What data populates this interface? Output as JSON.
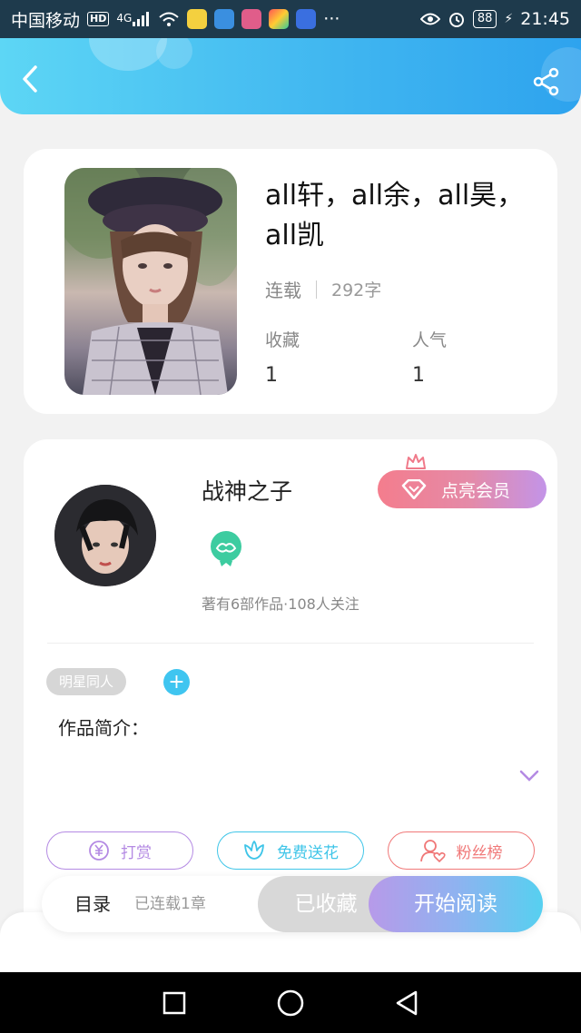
{
  "status_bar": {
    "carrier": "中国移动",
    "hd": "HD",
    "signal": "4G",
    "dots": "···",
    "battery": "88",
    "time": "21:45"
  },
  "header": {
    "back_icon": "chevron-left-icon",
    "share_icon": "share-icon"
  },
  "book": {
    "title": "all轩，all余，all昊，all凯",
    "status": "连载",
    "word_count": "292字",
    "favorites_label": "收藏",
    "favorites_value": "1",
    "popularity_label": "人气",
    "popularity_value": "1"
  },
  "author": {
    "name": "战神之子",
    "vip_button": "点亮会员",
    "meta": "著有6部作品·108人关注"
  },
  "tags": {
    "items": [
      "明星同人"
    ],
    "add": "+"
  },
  "intro": {
    "label": "作品简介："
  },
  "actions": {
    "tip": "打赏",
    "flower": "免费送花",
    "fans": "粉丝榜"
  },
  "bottom": {
    "toc": "目录",
    "progress": "已连载1章",
    "collected": "已收藏",
    "read": "开始阅读"
  },
  "colors": {
    "header_start": "#5dd6f5",
    "header_end": "#2ea3ee",
    "vip_start": "#f47d8d",
    "vip_end": "#c394e8",
    "tip": "#b48ae3",
    "flower": "#3fc5e8",
    "fans": "#f07878"
  }
}
